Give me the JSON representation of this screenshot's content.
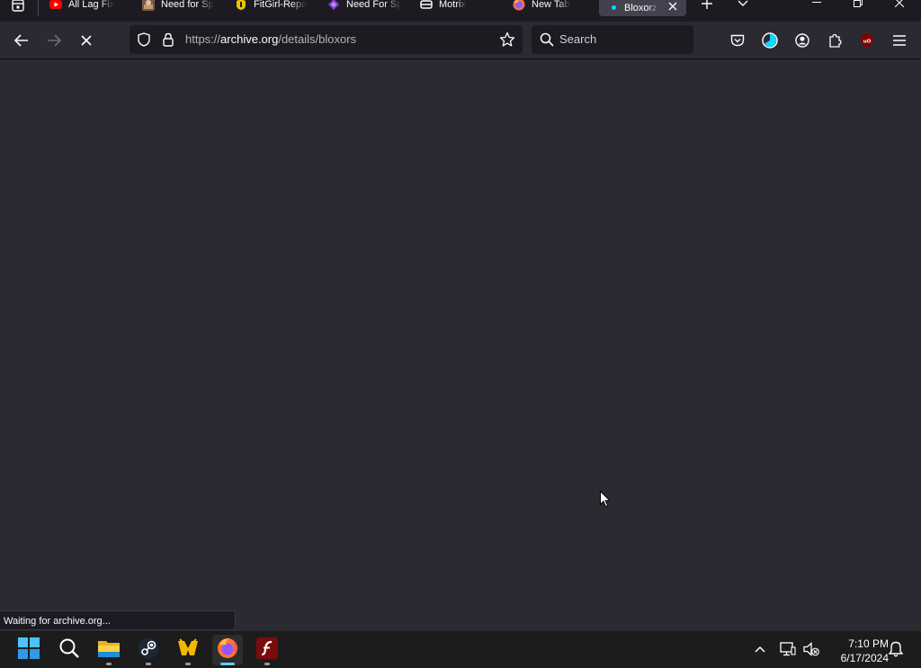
{
  "tabs": [
    {
      "label": "All Lag Fix",
      "icon": "youtube-icon"
    },
    {
      "label": "Need for Sp",
      "icon": "game-thumbnail-icon"
    },
    {
      "label": "FitGirl-Repa",
      "icon": "fitgirl-icon"
    },
    {
      "label": "Need For Sp",
      "icon": "purple-shield-icon"
    },
    {
      "label": "Motrix",
      "icon": "motrix-icon"
    },
    {
      "label": "New Tab",
      "icon": "firefox-icon"
    },
    {
      "label": "Bloxorz",
      "icon": "archive-icon"
    }
  ],
  "navbar": {
    "url_host": "archive.org",
    "url_scheme": "https://",
    "url_path": "/details/bloxors",
    "search_placeholder": "Search"
  },
  "status_text": "Waiting for archive.org...",
  "taskbar": {
    "apps": [
      "start-icon",
      "search-icon",
      "file-explorer-icon",
      "steam-icon",
      "motrix-icon",
      "firefox-icon",
      "flash-player-icon"
    ]
  },
  "clock": {
    "time": "7:10 PM",
    "date": "6/17/2024"
  },
  "colors": {
    "content_bg": "#2b2a33",
    "toolbar_bg": "#1c1b22",
    "accent": "#00ddff"
  }
}
